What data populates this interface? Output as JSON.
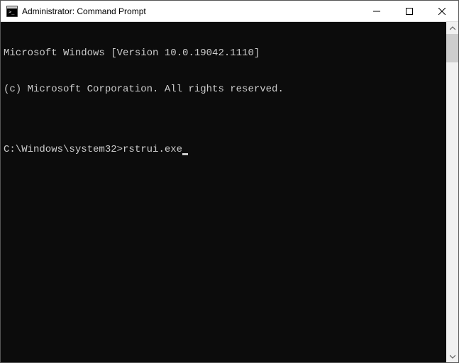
{
  "window": {
    "title": "Administrator: Command Prompt"
  },
  "terminal": {
    "line1": "Microsoft Windows [Version 10.0.19042.1110]",
    "line2": "(c) Microsoft Corporation. All rights reserved.",
    "blank": "",
    "prompt": "C:\\Windows\\system32>",
    "command": "rstrui.exe"
  }
}
